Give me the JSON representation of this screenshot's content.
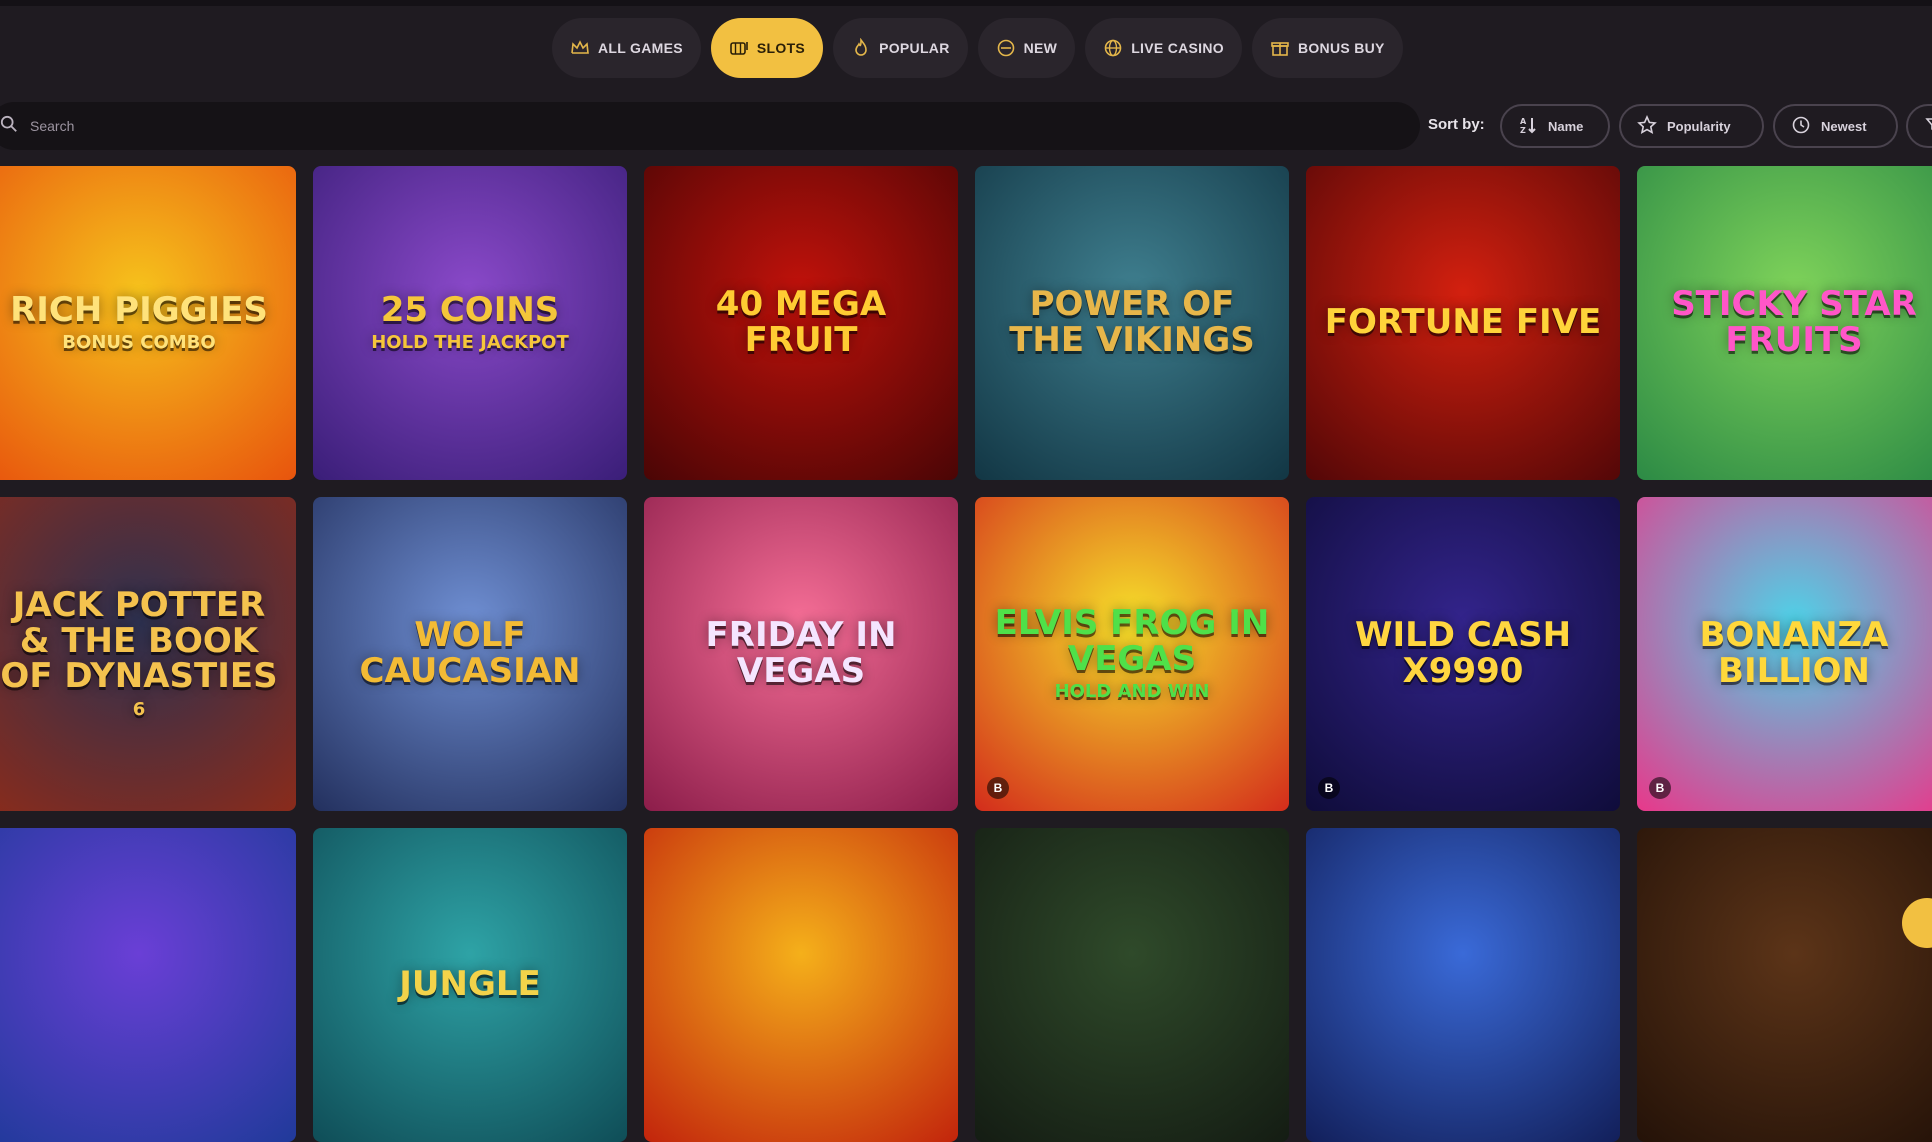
{
  "tabs": [
    {
      "label": "ALL GAMES",
      "icon": "crown-icon"
    },
    {
      "label": "SLOTS",
      "icon": "slot-machine-icon"
    },
    {
      "label": "POPULAR",
      "icon": "flame-icon"
    },
    {
      "label": "NEW",
      "icon": "new-badge-icon"
    },
    {
      "label": "LIVE CASINO",
      "icon": "globe-icon"
    },
    {
      "label": "BONUS BUY",
      "icon": "gift-icon"
    }
  ],
  "active_tab": "SLOTS",
  "search": {
    "placeholder": "Search"
  },
  "sort": {
    "label": "Sort by:",
    "options": [
      {
        "label": "Name",
        "icon": "sort-alpha-icon"
      },
      {
        "label": "Popularity",
        "icon": "star-outline-icon"
      },
      {
        "label": "Newest",
        "icon": "clock-icon"
      }
    ]
  },
  "games": [
    {
      "title": "RICH PIGGIES",
      "subtitle": "BONUS COMBO",
      "colors": [
        "#f6c21c",
        "#e8540d"
      ],
      "text_color": "#ffe27a",
      "badge": ""
    },
    {
      "title": "25 COINS",
      "subtitle": "HOLD THE JACKPOT",
      "colors": [
        "#8a49c9",
        "#3a1e78"
      ],
      "text_color": "#f5c63a",
      "badge": ""
    },
    {
      "title": "40 MEGA FRUIT",
      "subtitle": "",
      "colors": [
        "#c1120b",
        "#4a0505"
      ],
      "text_color": "#ffcc33",
      "badge": ""
    },
    {
      "title": "POWER OF THE VIKINGS",
      "subtitle": "",
      "colors": [
        "#3f7f8f",
        "#123644"
      ],
      "text_color": "#e7b64a",
      "badge": ""
    },
    {
      "title": "FORTUNE FIVE",
      "subtitle": "",
      "colors": [
        "#d3200f",
        "#530707"
      ],
      "text_color": "#ffd33a",
      "badge": ""
    },
    {
      "title": "STICKY STAR FRUITS",
      "subtitle": "",
      "colors": [
        "#7fd35a",
        "#2c8a45"
      ],
      "text_color": "#ff56c8",
      "badge": ""
    },
    {
      "title": "JACK POTTER & THE BOOK OF DYNASTIES",
      "subtitle": "6",
      "colors": [
        "#2d3150",
        "#8a2b1b"
      ],
      "text_color": "#f4c24e",
      "badge": ""
    },
    {
      "title": "WOLF CAUCASIAN",
      "subtitle": "",
      "colors": [
        "#6f8fd3",
        "#23305e"
      ],
      "text_color": "#f3bb35",
      "badge": ""
    },
    {
      "title": "FRIDAY IN VEGAS",
      "subtitle": "",
      "colors": [
        "#f56e96",
        "#8c1d4a"
      ],
      "text_color": "#f5e5ff",
      "badge": ""
    },
    {
      "title": "ELVIS FROG IN VEGAS",
      "subtitle": "HOLD AND WIN",
      "colors": [
        "#f6e02a",
        "#d32c1b"
      ],
      "text_color": "#4fe049",
      "badge": "B"
    },
    {
      "title": "WILD CASH X9990",
      "subtitle": "",
      "colors": [
        "#33248c",
        "#0f0c3a"
      ],
      "text_color": "#ffd640",
      "badge": "B"
    },
    {
      "title": "BONANZA BILLION",
      "subtitle": "",
      "colors": [
        "#4ed2e8",
        "#e8388a"
      ],
      "text_color": "#ffd83b",
      "badge": "B"
    },
    {
      "title": "",
      "subtitle": "",
      "colors": [
        "#6a3fd6",
        "#203a9a"
      ],
      "text_color": "#ffffff",
      "badge": ""
    },
    {
      "title": "JUNGLE",
      "subtitle": "",
      "colors": [
        "#2ea3a6",
        "#0f4d57"
      ],
      "text_color": "#f3d34a",
      "badge": ""
    },
    {
      "title": "",
      "subtitle": "",
      "colors": [
        "#f5b01a",
        "#c2240c"
      ],
      "text_color": "#ffffff",
      "badge": ""
    },
    {
      "title": "",
      "subtitle": "",
      "colors": [
        "#2f4a2a",
        "#141c13"
      ],
      "text_color": "#ffffff",
      "badge": ""
    },
    {
      "title": "",
      "subtitle": "",
      "colors": [
        "#3a6ad8",
        "#121f5a"
      ],
      "text_color": "#ffffff",
      "badge": ""
    },
    {
      "title": "",
      "subtitle": "",
      "colors": [
        "#5c3418",
        "#241208"
      ],
      "text_color": "#ffffff",
      "badge": ""
    }
  ]
}
